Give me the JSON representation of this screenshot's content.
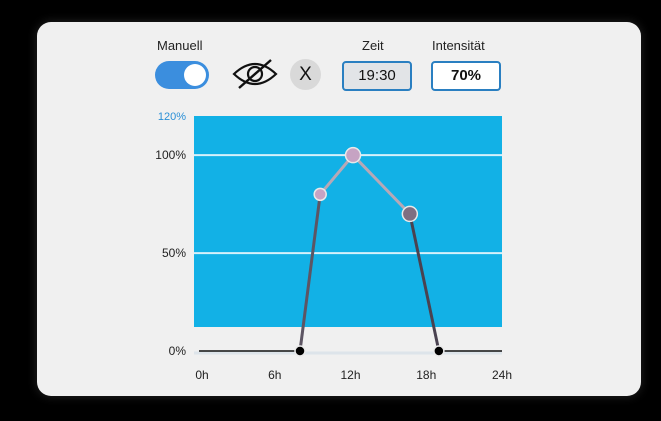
{
  "header": {
    "manual_label": "Manuell",
    "manual_on": true,
    "time_label": "Zeit",
    "time_value": "19:30",
    "intensity_label": "Intensität",
    "intensity_value": "70%",
    "close_label": "X",
    "visibility_icon": "eye-off-icon"
  },
  "colors": {
    "accent": "#3b8ede",
    "plot_fill": "#12b1e6",
    "point_light": "#c6a3c3",
    "point_dark": "#7f6e82",
    "line": "#b7a8b6"
  },
  "chart_data": {
    "type": "line",
    "x": [
      0,
      8,
      9.6,
      12.2,
      16.7,
      19,
      24
    ],
    "y": [
      0,
      0,
      80,
      100,
      70,
      0,
      0
    ],
    "xticks": [
      "0h",
      "6h",
      "12h",
      "18h",
      "24h"
    ],
    "xtick_values": [
      0,
      6,
      12,
      18,
      24
    ],
    "yticks": [
      "0%",
      "50%",
      "100%",
      "120%"
    ],
    "ytick_values": [
      0,
      50,
      100,
      120
    ],
    "xlim": [
      0,
      24
    ],
    "ylim": [
      0,
      120
    ],
    "grid": true,
    "highlight_y": 120
  }
}
